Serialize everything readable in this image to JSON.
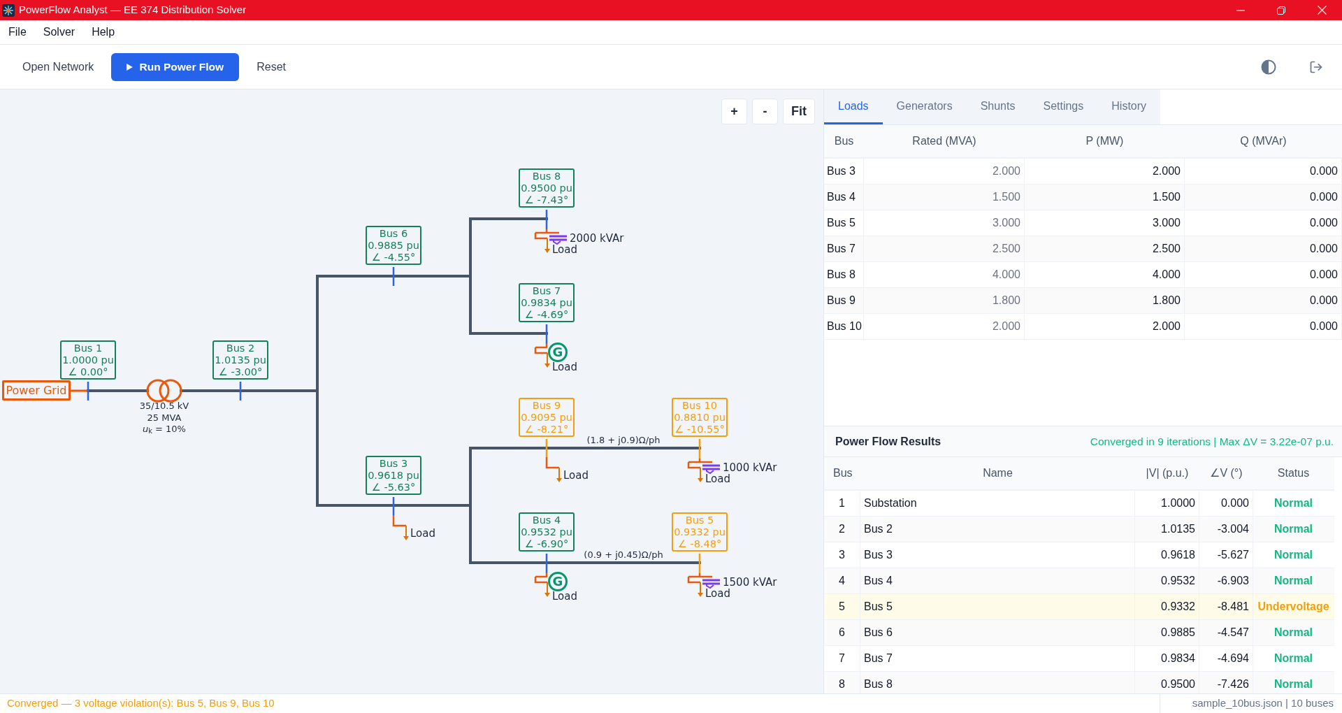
{
  "window": {
    "title": "PowerFlow Analyst — EE 374 Distribution Solver"
  },
  "menu": [
    {
      "label": "File"
    },
    {
      "label": "Solver"
    },
    {
      "label": "Help"
    }
  ],
  "toolbar": {
    "buttons": [
      {
        "label": "Open Network",
        "kind": "plain"
      },
      {
        "label": "Run Power Flow",
        "kind": "primary"
      },
      {
        "label": "Reset",
        "kind": "plain"
      }
    ]
  },
  "diagram": {
    "zoom_controls": [
      {
        "label": "+"
      },
      {
        "label": "-"
      },
      {
        "label": "Fit"
      }
    ],
    "buses": [
      {
        "name": "Bus 6",
        "voltage": "0.9885 pu",
        "angle": "∠ -4.55°",
        "violation": false
      },
      {
        "name": "Bus 8",
        "voltage": "0.9500 pu",
        "angle": "∠ -7.43°",
        "violation": false,
        "load": "Load",
        "shunt": "2000 kVAr"
      },
      {
        "name": "Bus 1",
        "voltage": "1.0000 pu",
        "angle": "∠ 0.00°",
        "violation": false
      },
      {
        "name": "Bus 2",
        "voltage": "1.0135 pu",
        "angle": "∠ -3.00°",
        "violation": false
      },
      {
        "name": "Bus 7",
        "voltage": "0.9834 pu",
        "angle": "∠ -4.69°",
        "violation": false,
        "load": "Load",
        "generator": "G"
      },
      {
        "name": "Bus 3",
        "voltage": "0.9618 pu",
        "angle": "∠ -5.63°",
        "violation": false,
        "load": "Load"
      },
      {
        "name": "Bus 9",
        "voltage": "0.9095 pu",
        "angle": "∠ -8.21°",
        "violation": true,
        "load": "Load"
      },
      {
        "name": "Bus 10",
        "voltage": "0.8810 pu",
        "angle": "∠ -10.55°",
        "violation": true,
        "load": "Load",
        "shunt": "1000 kVAr"
      },
      {
        "name": "Bus 4",
        "voltage": "0.9532 pu",
        "angle": "∠ -6.90°",
        "violation": false,
        "load": "Load",
        "generator": "G"
      },
      {
        "name": "Bus 5",
        "voltage": "0.9332 pu",
        "angle": "∠ -8.48°",
        "violation": true,
        "load": "Load",
        "shunt": "1500 kVAr"
      }
    ],
    "source": {
      "label": "Power Grid"
    },
    "transformer": {
      "lines": [
        "35/10.5 kV",
        "25 MVA",
        "*u*$_{k}$ = 10%"
      ]
    },
    "line_labels": [
      "(1.8 + j0.9)Ω/ph",
      "(0.9 + j0.45)Ω/ph"
    ]
  },
  "side_panel": {
    "tabs": [
      {
        "label": "Loads",
        "selected": true
      },
      {
        "label": "Generators",
        "selected": false
      },
      {
        "label": "Shunts",
        "selected": false
      },
      {
        "label": "Settings",
        "selected": false
      },
      {
        "label": "History",
        "selected": false
      }
    ],
    "loads_table": {
      "columns": [
        "Bus",
        "Rated (MVA)",
        "P (MW)",
        "Q (MVAr)"
      ],
      "rows": [
        [
          "Bus 3",
          "2.000",
          "2.000",
          "0.000"
        ],
        [
          "Bus 4",
          "1.500",
          "1.500",
          "0.000"
        ],
        [
          "Bus 5",
          "3.000",
          "3.000",
          "0.000"
        ],
        [
          "Bus 7",
          "2.500",
          "2.500",
          "0.000"
        ],
        [
          "Bus 8",
          "4.000",
          "4.000",
          "0.000"
        ],
        [
          "Bus 9",
          "1.800",
          "1.800",
          "0.000"
        ],
        [
          "Bus 10",
          "2.000",
          "2.000",
          "0.000"
        ]
      ]
    },
    "results": {
      "title": "Power Flow Results",
      "summary": "Converged in 9 iterations | Max ΔV = 3.22e-07 p.u.",
      "columns": [
        "Bus",
        "Name",
        "|V| (p.u.)",
        "∠V (°)",
        "Status"
      ],
      "rows": [
        {
          "bus": "1",
          "name": "Substation",
          "v": "1.0000",
          "angle": "0.000",
          "status": "Normal",
          "violation": false
        },
        {
          "bus": "2",
          "name": "Bus 2",
          "v": "1.0135",
          "angle": "-3.004",
          "status": "Normal",
          "violation": false
        },
        {
          "bus": "3",
          "name": "Bus 3",
          "v": "0.9618",
          "angle": "-5.627",
          "status": "Normal",
          "violation": false
        },
        {
          "bus": "4",
          "name": "Bus 4",
          "v": "0.9532",
          "angle": "-6.903",
          "status": "Normal",
          "violation": false
        },
        {
          "bus": "5",
          "name": "Bus 5",
          "v": "0.9332",
          "angle": "-8.481",
          "status": "Undervoltage",
          "violation": true
        },
        {
          "bus": "6",
          "name": "Bus 6",
          "v": "0.9885",
          "angle": "-4.547",
          "status": "Normal",
          "violation": false
        },
        {
          "bus": "7",
          "name": "Bus 7",
          "v": "0.9834",
          "angle": "-4.694",
          "status": "Normal",
          "violation": false
        },
        {
          "bus": "8",
          "name": "Bus 8",
          "v": "0.9500",
          "angle": "-7.426",
          "status": "Normal",
          "violation": false
        }
      ]
    }
  },
  "status_bar": {
    "message": "Converged — 3 voltage violation(s): Bus 5, Bus 9, Bus 10",
    "file_info": "sample_10bus.json | 10 buses"
  }
}
